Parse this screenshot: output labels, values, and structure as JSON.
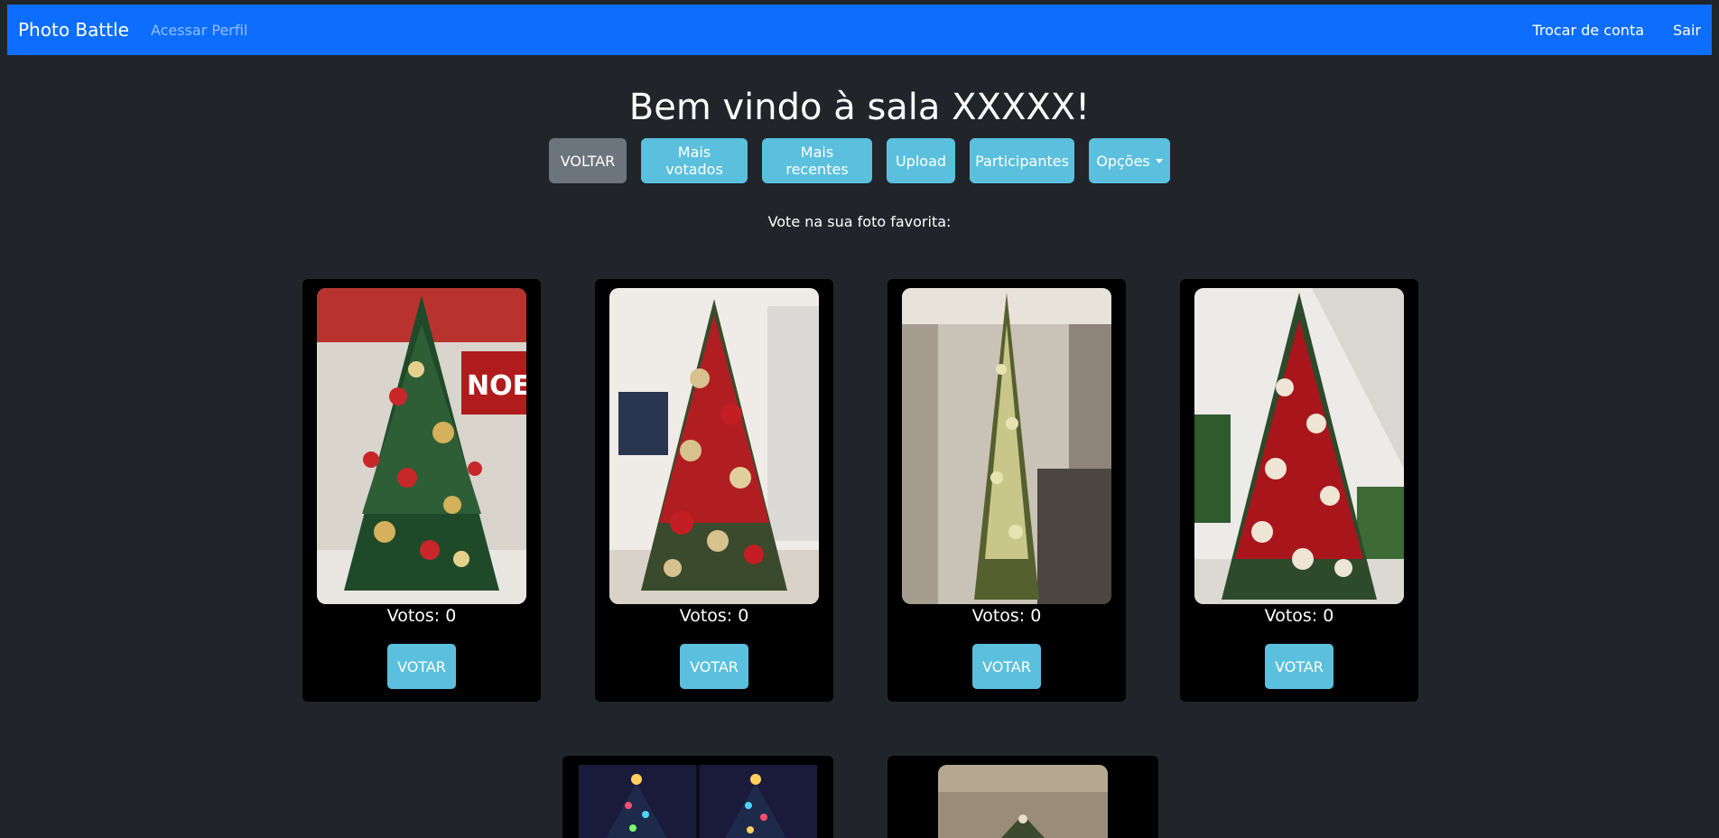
{
  "navbar": {
    "brand": "Photo Battle",
    "profile_link": "Acessar Perfil",
    "switch_account": "Trocar de conta",
    "logout": "Sair",
    "color": "#0d6efd"
  },
  "main": {
    "title": "Bem vindo à sala XXXXX!",
    "buttons": {
      "back": "VOLTAR",
      "most_voted": "Mais votados",
      "most_recent": "Mais recentes",
      "upload": "Upload",
      "participants": "Participantes",
      "options": "Opções"
    },
    "subtitle": "Vote na sua foto favorita:"
  },
  "photos": [
    {
      "votes_label": "Votos: 0",
      "vote_button": "VOTAR"
    },
    {
      "votes_label": "Votos: 0",
      "vote_button": "VOTAR"
    },
    {
      "votes_label": "Votos: 0",
      "vote_button": "VOTAR"
    },
    {
      "votes_label": "Votos: 0",
      "vote_button": "VOTAR"
    }
  ],
  "colors": {
    "background": "#212529",
    "info": "#5bc0de",
    "secondary": "#6c757d"
  }
}
